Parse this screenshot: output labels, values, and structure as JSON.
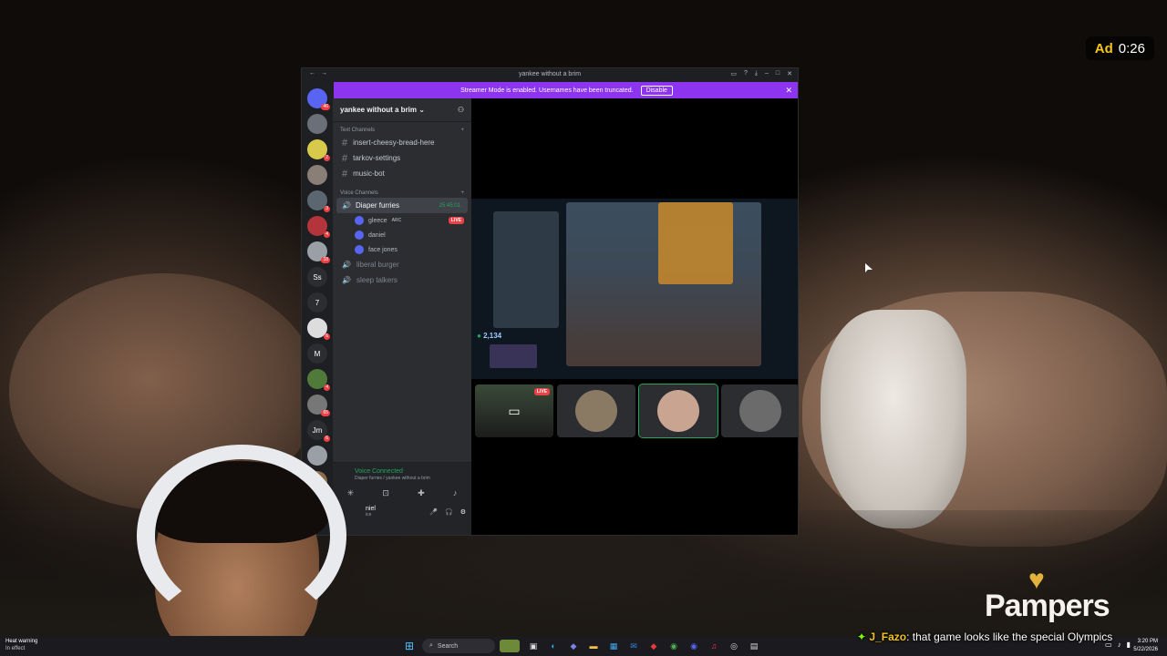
{
  "ad": {
    "label": "Ad",
    "time": "0:26"
  },
  "brand": {
    "name": "Pampers",
    "heart": "♥"
  },
  "discord": {
    "window_title": "yankee without a brim",
    "streamer_banner": {
      "text": "Streamer Mode is enabled. Usernames have been truncated.",
      "button": "Disable"
    },
    "server_name": "yankee without a brim",
    "servers": [
      {
        "label": "",
        "badge": "46",
        "color": "#5865f2"
      },
      {
        "label": "",
        "badge": "",
        "color": "#6b6f78"
      },
      {
        "label": "",
        "badge": "2",
        "color": "#d9c94a"
      },
      {
        "label": "",
        "badge": "",
        "color": "#8a7f77"
      },
      {
        "label": "",
        "badge": "3",
        "color": "#5b6670"
      },
      {
        "label": "",
        "badge": "4",
        "color": "#b3343a"
      },
      {
        "label": "",
        "badge": "18",
        "color": "#9aa0a6"
      },
      {
        "label": "Ss",
        "badge": "",
        "color": "#2b2d31"
      },
      {
        "label": "7",
        "badge": "",
        "color": "#2b2d31"
      },
      {
        "label": "",
        "badge": "6",
        "color": "#ddd"
      },
      {
        "label": "M",
        "badge": "",
        "color": "#2b2d31"
      },
      {
        "label": "",
        "badge": "4",
        "color": "#4f7a3a"
      },
      {
        "label": "",
        "badge": "65",
        "color": "#777"
      },
      {
        "label": "Jm",
        "badge": "6",
        "color": "#2b2d31"
      },
      {
        "label": "",
        "badge": "",
        "color": "#9aa0a6"
      },
      {
        "label": "",
        "badge": "14",
        "color": "#8a6e4b"
      },
      {
        "label": "",
        "badge": "NEW",
        "color": "#b3343a"
      }
    ],
    "text_category": "Text Channels",
    "text_channels": [
      "insert-cheesy-bread-here",
      "tarkov-settings",
      "music-bot"
    ],
    "voice_category": "Voice Channels",
    "active_voice": {
      "name": "Diaper furries",
      "timer": "25:45:01"
    },
    "voice_users": [
      {
        "name": "gleece",
        "tag": "ARC",
        "live": "LIVE"
      },
      {
        "name": "daniel",
        "tag": "",
        "live": ""
      },
      {
        "name": "face jones",
        "tag": "",
        "live": ""
      }
    ],
    "other_voice": [
      "liberal burger",
      "sleep talkers"
    ],
    "voice_panel": {
      "status": "Voice Connected",
      "sub": "Diaper furries / yankee without a brim",
      "user": "niel",
      "user_sub": "ice"
    },
    "stream_hud": {
      "gold": "2,134"
    },
    "tiles": [
      {
        "kind": "stream",
        "live": "LIVE"
      },
      {
        "kind": "avatar",
        "color": "#8a7a63"
      },
      {
        "kind": "avatar",
        "color": "#c9a490"
      },
      {
        "kind": "avatar",
        "color": "#6b6b6b"
      }
    ]
  },
  "taskbar": {
    "weather_1": "Heat warning",
    "weather_2": "In effect",
    "search": "Search",
    "time": "3:20 PM",
    "date": "5/22/2026"
  },
  "chat": {
    "user": "J_Fazo",
    "message": "that game looks like the special Olympics"
  }
}
